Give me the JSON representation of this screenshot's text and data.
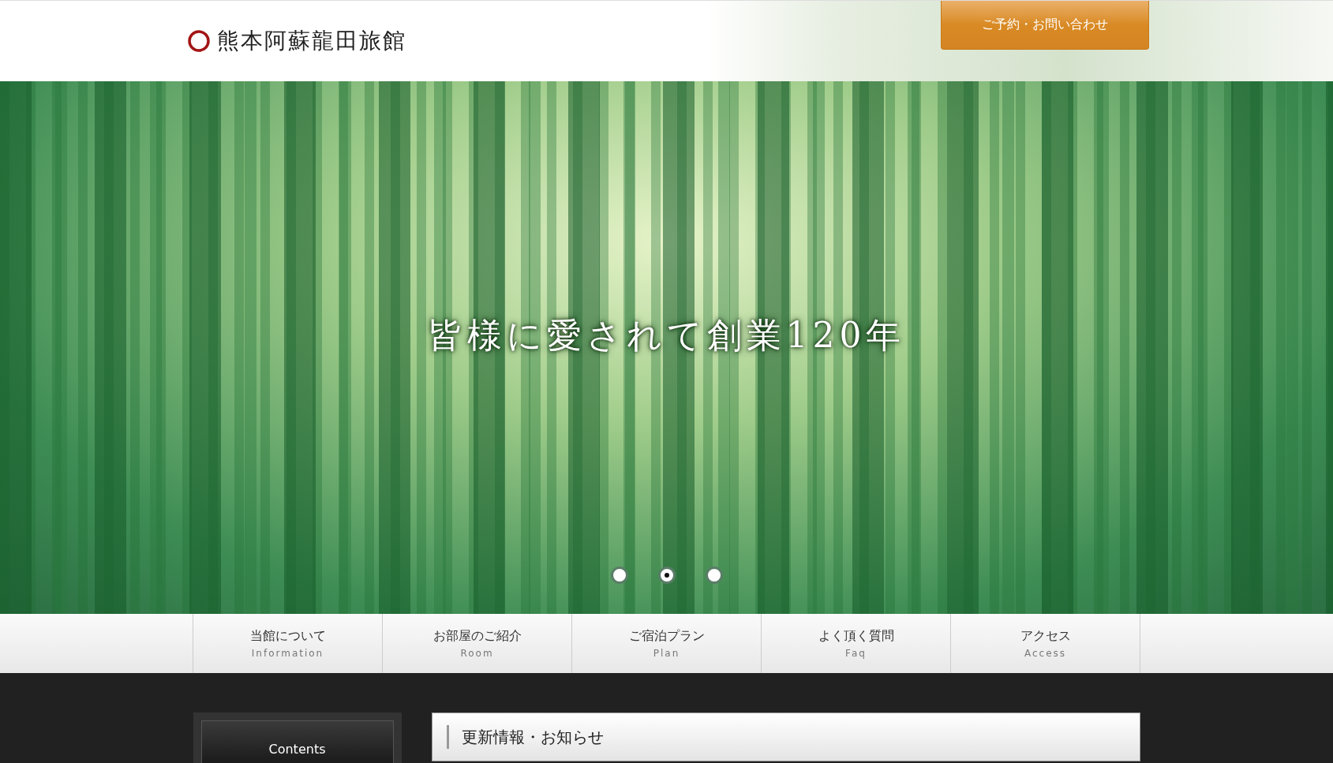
{
  "header": {
    "logo": "熊本阿蘇龍田旅館",
    "contact_button": "ご予約・お問い合わせ"
  },
  "hero": {
    "headline": "皆様に愛されて創業120年",
    "slides": [
      {
        "selected": false
      },
      {
        "selected": true
      },
      {
        "selected": false
      }
    ]
  },
  "nav": [
    {
      "label": "当館について",
      "sub": "Information"
    },
    {
      "label": "お部屋のご紹介",
      "sub": "Room"
    },
    {
      "label": "ご宿泊プラン",
      "sub": "Plan"
    },
    {
      "label": "よく頂く質問",
      "sub": "Faq"
    },
    {
      "label": "アクセス",
      "sub": "Access"
    }
  ],
  "sidebar": {
    "title": "Contents"
  },
  "news": {
    "title": "更新情報・お知らせ"
  }
}
